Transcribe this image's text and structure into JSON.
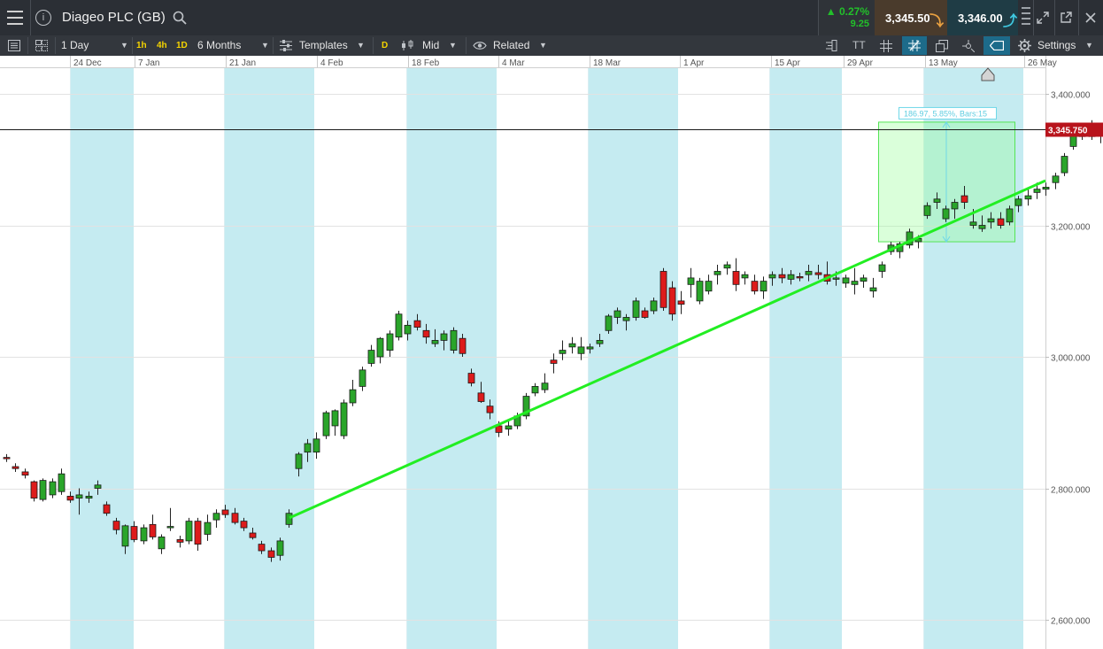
{
  "header": {
    "instrument": "Diageo PLC (GB)",
    "info_icon_label": "i",
    "change_percent": "▲ 0.27%",
    "change_abs": "9.25",
    "sell_price": "3,345.50",
    "buy_price": "3,346.00",
    "colors": {
      "up": "#22c02a",
      "sell_bg": "#4a3b2c",
      "buy_bg": "#1f3c45",
      "sell_arrow": "#e8a040",
      "buy_arrow": "#3fc8e0"
    }
  },
  "toolbar": {
    "interval": "1 Day",
    "quick_1h": "1h",
    "quick_4h": "4h",
    "quick_1d": "1D",
    "range": "6 Months",
    "templates": "Templates",
    "d_tag": "D",
    "price_type": "Mid",
    "related": "Related",
    "settings": "Settings",
    "text_tool": "TT"
  },
  "chart_data": {
    "type": "candlestick",
    "title": "",
    "x_ticks": [
      "24 Dec",
      "7 Jan",
      "21 Jan",
      "4 Feb",
      "18 Feb",
      "4 Mar",
      "18 Mar",
      "1 Apr",
      "15 Apr",
      "29 Apr",
      "13 May",
      "26 May"
    ],
    "y_ticks": [
      "3,400.000",
      "3,200.000",
      "3,000.000",
      "2,800.000",
      "2,600.000"
    ],
    "ylim": [
      2565,
      3460
    ],
    "current_price_label": "3,345.750",
    "current_price": 3345.75,
    "trendline": {
      "from": [
        2755,
        "Feb"
      ],
      "to": [
        3268,
        "end"
      ]
    },
    "measure": {
      "label": "186.97, 5.85%, Bars:15",
      "low": 3175,
      "high": 3357
    },
    "candles": [
      [
        2847,
        2852,
        2840,
        2845
      ],
      [
        2833,
        2838,
        2825,
        2830
      ],
      [
        2825,
        2830,
        2815,
        2820
      ],
      [
        2810,
        2812,
        2780,
        2785
      ],
      [
        2783,
        2815,
        2780,
        2812
      ],
      [
        2790,
        2815,
        2785,
        2810
      ],
      [
        2795,
        2830,
        2790,
        2822
      ],
      [
        2788,
        2795,
        2778,
        2782
      ],
      [
        2785,
        2800,
        2760,
        2790
      ],
      [
        2785,
        2795,
        2778,
        2788
      ],
      [
        2800,
        2812,
        2790,
        2805
      ],
      [
        2775,
        2780,
        2758,
        2762
      ],
      [
        2750,
        2755,
        2730,
        2737
      ],
      [
        2712,
        2745,
        2700,
        2743
      ],
      [
        2742,
        2750,
        2718,
        2722
      ],
      [
        2720,
        2745,
        2715,
        2740
      ],
      [
        2745,
        2760,
        2722,
        2726
      ],
      [
        2708,
        2730,
        2700,
        2726
      ],
      [
        2740,
        2770,
        2735,
        2742
      ],
      [
        2722,
        2728,
        2710,
        2718
      ],
      [
        2720,
        2755,
        2715,
        2750
      ],
      [
        2750,
        2755,
        2705,
        2715
      ],
      [
        2730,
        2760,
        2720,
        2748
      ],
      [
        2752,
        2768,
        2740,
        2762
      ],
      [
        2767,
        2775,
        2755,
        2760
      ],
      [
        2762,
        2770,
        2745,
        2748
      ],
      [
        2750,
        2755,
        2735,
        2740
      ],
      [
        2732,
        2740,
        2722,
        2725
      ],
      [
        2715,
        2720,
        2700,
        2705
      ],
      [
        2705,
        2710,
        2688,
        2695
      ],
      [
        2698,
        2725,
        2690,
        2720
      ],
      [
        2745,
        2768,
        2740,
        2762
      ],
      [
        2830,
        2855,
        2818,
        2852
      ],
      [
        2855,
        2875,
        2840,
        2868
      ],
      [
        2855,
        2885,
        2845,
        2875
      ],
      [
        2880,
        2918,
        2875,
        2915
      ],
      [
        2895,
        2920,
        2880,
        2918
      ],
      [
        2880,
        2935,
        2875,
        2930
      ],
      [
        2930,
        2965,
        2925,
        2950
      ],
      [
        2955,
        2985,
        2948,
        2980
      ],
      [
        2990,
        3018,
        2985,
        3010
      ],
      [
        3000,
        3030,
        2990,
        3028
      ],
      [
        3010,
        3040,
        3000,
        3035
      ],
      [
        3030,
        3070,
        3025,
        3065
      ],
      [
        3035,
        3055,
        3025,
        3048
      ],
      [
        3055,
        3065,
        3040,
        3045
      ],
      [
        3040,
        3050,
        3020,
        3030
      ],
      [
        3020,
        3042,
        3015,
        3025
      ],
      [
        3025,
        3040,
        3010,
        3035
      ],
      [
        3010,
        3045,
        3005,
        3040
      ],
      [
        3028,
        3035,
        3000,
        3005
      ],
      [
        2975,
        2982,
        2955,
        2960
      ],
      [
        2945,
        2962,
        2930,
        2932
      ],
      [
        2925,
        2935,
        2905,
        2915
      ],
      [
        2895,
        2902,
        2878,
        2885
      ],
      [
        2890,
        2905,
        2880,
        2895
      ],
      [
        2895,
        2915,
        2890,
        2910
      ],
      [
        2910,
        2945,
        2905,
        2940
      ],
      [
        2945,
        2960,
        2940,
        2955
      ],
      [
        2950,
        2975,
        2945,
        2960
      ],
      [
        2995,
        3005,
        2975,
        2990
      ],
      [
        3005,
        3025,
        2995,
        3010
      ],
      [
        3015,
        3030,
        3005,
        3020
      ],
      [
        3005,
        3030,
        2995,
        3015
      ],
      [
        3012,
        3020,
        3005,
        3015
      ],
      [
        3020,
        3035,
        3015,
        3025
      ],
      [
        3040,
        3065,
        3035,
        3062
      ],
      [
        3060,
        3075,
        3050,
        3070
      ],
      [
        3055,
        3065,
        3040,
        3060
      ],
      [
        3060,
        3090,
        3055,
        3085
      ],
      [
        3070,
        3075,
        3058,
        3060
      ],
      [
        3070,
        3090,
        3065,
        3085
      ],
      [
        3130,
        3135,
        3070,
        3075
      ],
      [
        3105,
        3115,
        3055,
        3065
      ],
      [
        3085,
        3100,
        3065,
        3080
      ],
      [
        3110,
        3135,
        3090,
        3120
      ],
      [
        3085,
        3120,
        3080,
        3115
      ],
      [
        3100,
        3125,
        3095,
        3115
      ],
      [
        3125,
        3140,
        3110,
        3130
      ],
      [
        3135,
        3145,
        3125,
        3140
      ],
      [
        3130,
        3150,
        3100,
        3110
      ],
      [
        3120,
        3130,
        3110,
        3125
      ],
      [
        3115,
        3125,
        3095,
        3100
      ],
      [
        3100,
        3122,
        3088,
        3115
      ],
      [
        3120,
        3130,
        3108,
        3125
      ],
      [
        3125,
        3135,
        3112,
        3120
      ],
      [
        3118,
        3132,
        3110,
        3125
      ],
      [
        3122,
        3128,
        3115,
        3120
      ],
      [
        3125,
        3140,
        3115,
        3130
      ],
      [
        3128,
        3140,
        3118,
        3125
      ],
      [
        3125,
        3145,
        3110,
        3115
      ],
      [
        3118,
        3130,
        3108,
        3120
      ],
      [
        3112,
        3125,
        3105,
        3120
      ],
      [
        3110,
        3135,
        3095,
        3115
      ],
      [
        3115,
        3125,
        3105,
        3120
      ],
      [
        3100,
        3120,
        3090,
        3105
      ],
      [
        3130,
        3145,
        3120,
        3140
      ],
      [
        3160,
        3175,
        3155,
        3170
      ],
      [
        3160,
        3175,
        3150,
        3172
      ],
      [
        3170,
        3195,
        3165,
        3190
      ],
      [
        3175,
        3185,
        3165,
        3180
      ],
      [
        3215,
        3235,
        3210,
        3230
      ],
      [
        3235,
        3250,
        3225,
        3240
      ],
      [
        3210,
        3230,
        3205,
        3225
      ],
      [
        3225,
        3240,
        3210,
        3235
      ],
      [
        3245,
        3260,
        3225,
        3235
      ],
      [
        3200,
        3225,
        3195,
        3205
      ],
      [
        3195,
        3215,
        3190,
        3200
      ],
      [
        3205,
        3220,
        3195,
        3210
      ],
      [
        3210,
        3220,
        3195,
        3200
      ],
      [
        3205,
        3230,
        3200,
        3225
      ],
      [
        3230,
        3245,
        3220,
        3240
      ],
      [
        3240,
        3255,
        3230,
        3245
      ],
      [
        3250,
        3265,
        3240,
        3255
      ],
      [
        3255,
        3265,
        3245,
        3258
      ],
      [
        3265,
        3280,
        3255,
        3275
      ],
      [
        3280,
        3310,
        3275,
        3305
      ],
      [
        3320,
        3355,
        3315,
        3350
      ],
      [
        3335,
        3350,
        3330,
        3345
      ],
      [
        3355,
        3360,
        3330,
        3335
      ],
      [
        3340,
        3350,
        3325,
        3345
      ]
    ]
  }
}
